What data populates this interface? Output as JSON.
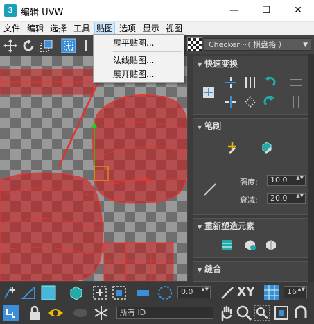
{
  "window": {
    "app_icon_letter": "3",
    "title": "编辑 UVW",
    "minimize_glyph": "—",
    "maximize_glyph": "☐",
    "close_glyph": "✕"
  },
  "menu": {
    "items": [
      "文件",
      "编辑",
      "选择",
      "工具",
      "贴图",
      "选项",
      "显示",
      "视图"
    ],
    "active": "贴图"
  },
  "dropdown": {
    "items": [
      "展平贴图...",
      "法线贴图...",
      "展开贴图..."
    ]
  },
  "checker": {
    "texture_label": "Checker···（ 棋盘格 ）",
    "arrow": "▼"
  },
  "panel": {
    "quick_transform": {
      "title": "快速变换"
    },
    "brush": {
      "title": "笔刷",
      "strength_label": "强度:",
      "strength_value": "10.0",
      "falloff_label": "衰减:",
      "falloff_value": "20.0"
    },
    "reshape": {
      "title": "重新塑造元素"
    },
    "stitch": {
      "title": "缝合"
    }
  },
  "bottom": {
    "rotate_value": "0.0",
    "xy_label": "XY",
    "grid_value": "16",
    "selection_filter": "所有 ID",
    "spinner_glyph": "▲▼"
  },
  "colors": {
    "accent_blue": "#3a8fd8",
    "uv_red": "#c02020",
    "annotation_arrow": "#e03030"
  },
  "icons": [
    "move-icon",
    "rotate-icon",
    "scale-icon",
    "freeform-icon",
    "mirror-icon",
    "settings-gear-icon",
    "vertex-mode-icon",
    "edge-mode-icon",
    "face-mode-icon",
    "element-mode-icon",
    "lock-icon",
    "eye-icon",
    "snowflake-icon",
    "pan-hand-icon",
    "zoom-icon",
    "zoom-region-icon",
    "frame-icon",
    "snap-icon"
  ]
}
